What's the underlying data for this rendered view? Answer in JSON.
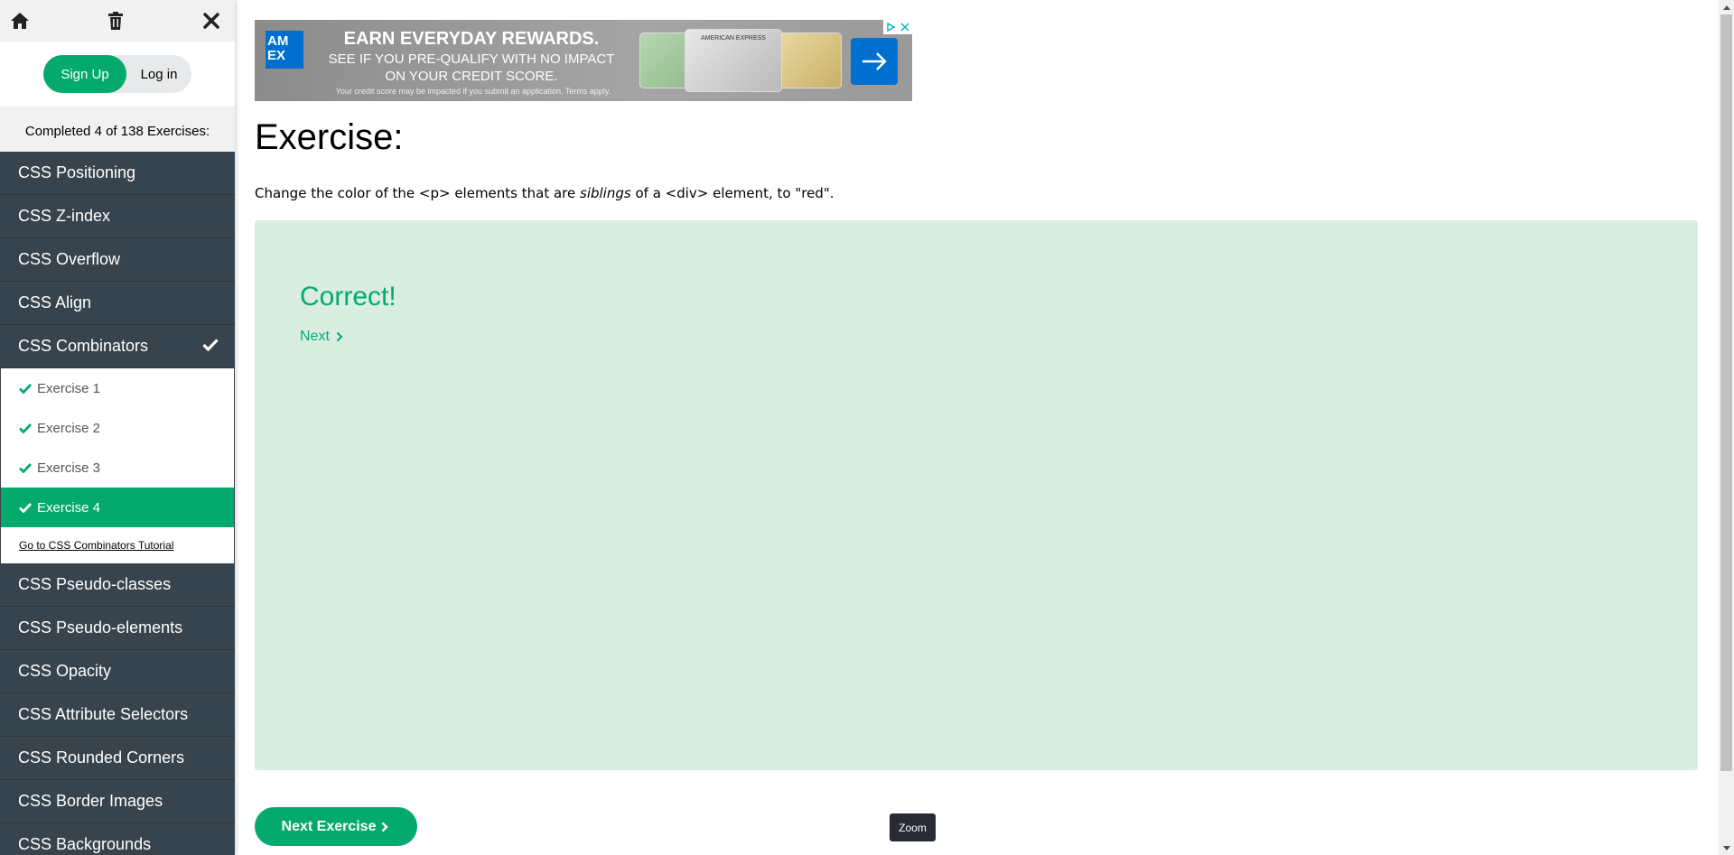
{
  "sidebar": {
    "icons": {
      "home": "home-icon",
      "trash": "trash-icon",
      "close": "close-icon"
    },
    "signup_label": "Sign Up",
    "login_label": "Log in",
    "progress_text": "Completed 4 of 138 Exercises:",
    "topics_before": [
      "CSS Positioning",
      "CSS Z-index",
      "CSS Overflow",
      "CSS Align"
    ],
    "active_topic": "CSS Combinators",
    "exercises": [
      "Exercise 1",
      "Exercise 2",
      "Exercise 3",
      "Exercise 4"
    ],
    "active_exercise_index": 3,
    "tutorial_link": "Go to CSS Combinators Tutorial",
    "topics_after": [
      "CSS Pseudo-classes",
      "CSS Pseudo-elements",
      "CSS Opacity",
      "CSS Attribute Selectors",
      "CSS Rounded Corners",
      "CSS Border Images",
      "CSS Backgrounds"
    ]
  },
  "ad": {
    "logo_text": "AM EX",
    "headline": "EARN EVERYDAY REWARDS.",
    "subline": "SEE IF YOU PRE-QUALIFY WITH NO IMPACT ON YOUR CREDIT SCORE.",
    "fineprint": "Your credit score may be impacted if you submit an application. Terms apply.",
    "card_label": "AMERICAN EXPRESS"
  },
  "main": {
    "heading": "Exercise:",
    "instruction_parts": {
      "before": "Change the color of the <p> elements that are ",
      "emph": "siblings",
      "after": " of a <div> element, to \"red\"."
    },
    "result_title": "Correct!",
    "next_link": "Next",
    "next_exercise_button": "Next Exercise",
    "zoom_label": "Zoom"
  },
  "colors": {
    "accent": "#04aa6d",
    "sidebar_topic_bg": "#38444d",
    "result_bg": "#d9eee1"
  }
}
